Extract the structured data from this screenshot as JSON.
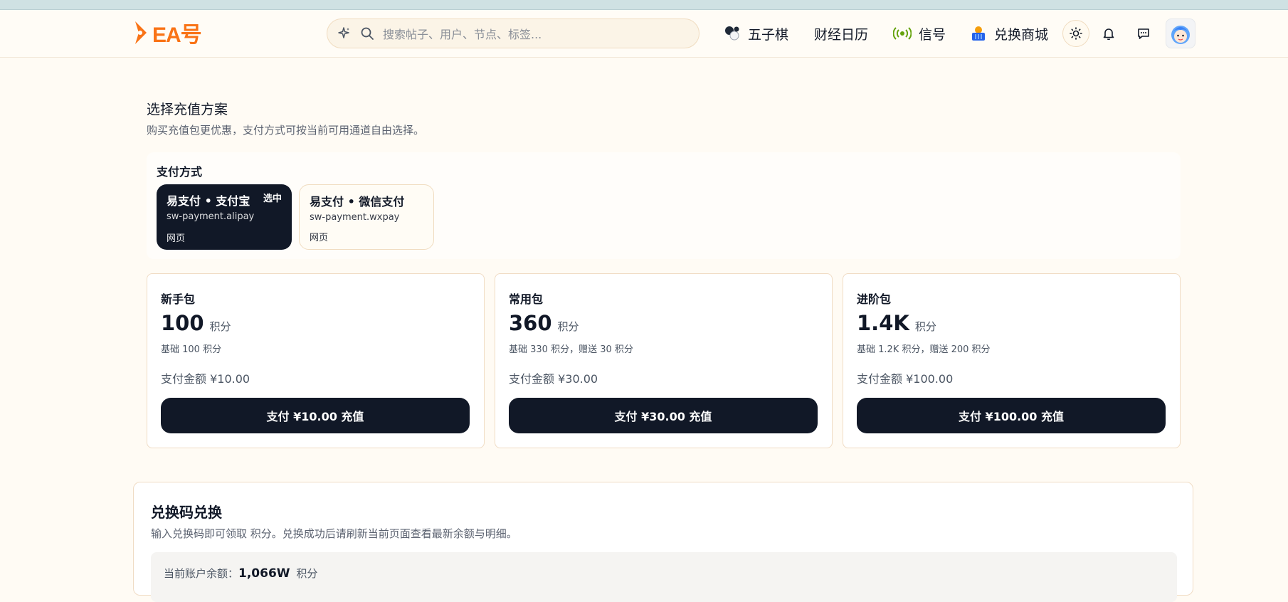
{
  "header": {
    "logo_text": "EA号",
    "search_placeholder": "搜索帖子、用户、节点、标签...",
    "nav": {
      "gomoku": "五子棋",
      "calendar": "财经日历",
      "signal": "信号",
      "store": "兑换商城"
    }
  },
  "plans_section": {
    "title": "选择充值方案",
    "subtitle": "购买充值包更优惠，支付方式可按当前可用通道自由选择。",
    "payment_label": "支付方式",
    "payment_methods": [
      {
        "title": "易支付 • 支付宝",
        "code": "sw-payment.alipay",
        "kind": "网页",
        "badge": "选中"
      },
      {
        "title": "易支付 • 微信支付",
        "code": "sw-payment.wxpay",
        "kind": "网页"
      }
    ],
    "packages": [
      {
        "name": "新手包",
        "points": "100",
        "unit": "积分",
        "detail": "基础 100 积分",
        "amount": "支付金额 ¥10.00",
        "button": "支付 ¥10.00 充值"
      },
      {
        "name": "常用包",
        "points": "360",
        "unit": "积分",
        "detail": "基础 330 积分，赠送 30 积分",
        "amount": "支付金额 ¥30.00",
        "button": "支付 ¥30.00 充值"
      },
      {
        "name": "进阶包",
        "points": "1.4K",
        "unit": "积分",
        "detail": "基础 1.2K 积分，赠送 200 积分",
        "amount": "支付金额 ¥100.00",
        "button": "支付 ¥100.00 充值"
      }
    ]
  },
  "redeem": {
    "title": "兑换码兑换",
    "desc": "输入兑换码即可领取 积分。兑换成功后请刷新当前页面查看最新余额与明细。",
    "balance_label": "当前账户余额：",
    "balance_value": "1,066W",
    "balance_unit": "积分"
  },
  "colors": {
    "accent": "#f97316",
    "dark": "#111827",
    "background": "#fffbf4"
  }
}
